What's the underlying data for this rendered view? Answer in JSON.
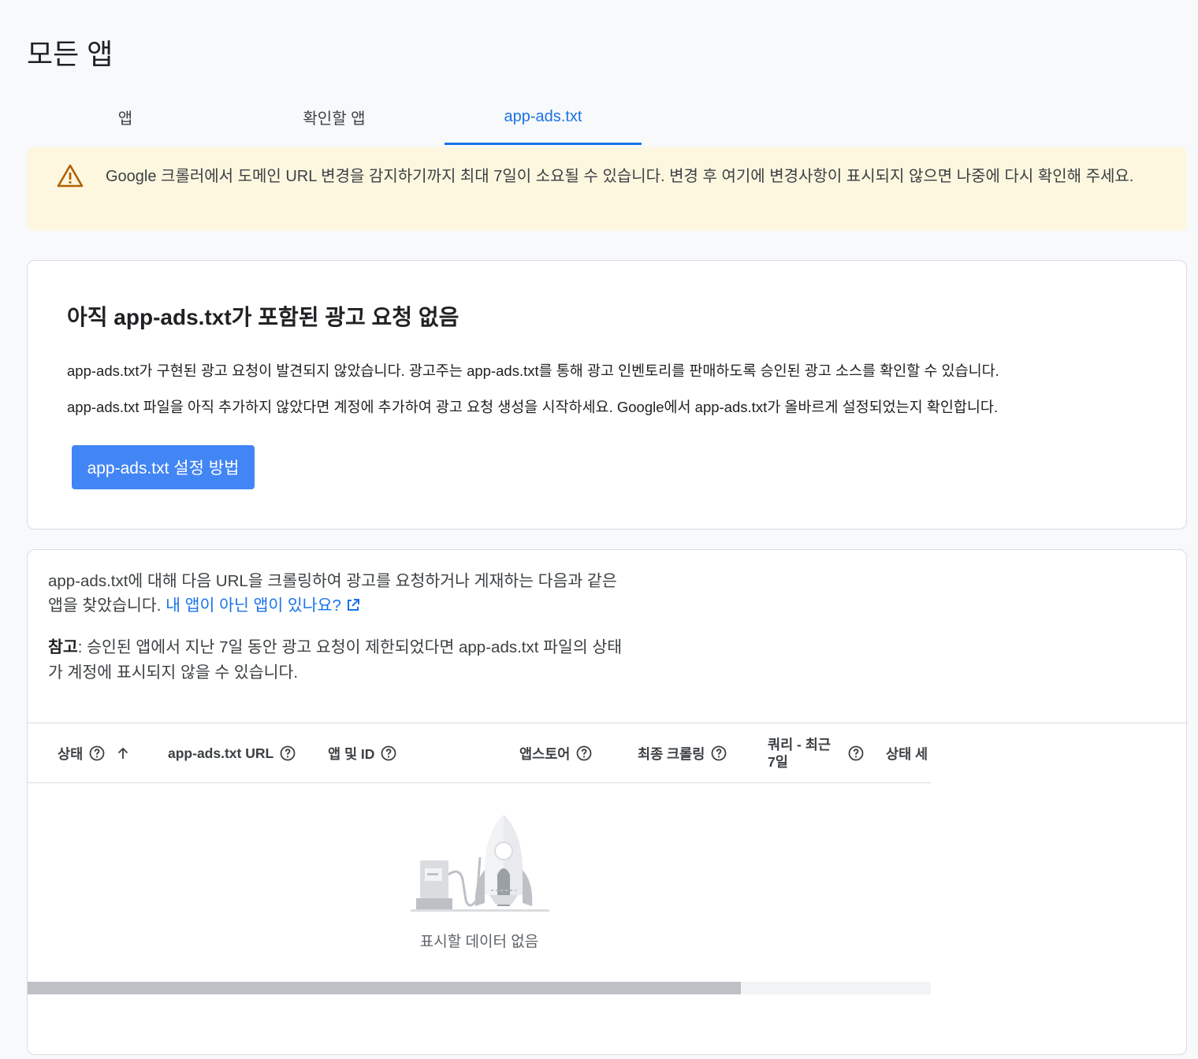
{
  "page": {
    "title": "모든 앱"
  },
  "tabs": [
    {
      "label": "앱",
      "active": false
    },
    {
      "label": "확인할 앱",
      "active": false
    },
    {
      "label": "app-ads.txt",
      "active": true
    }
  ],
  "warning": {
    "icon": "warning-triangle-icon",
    "text": "Google 크롤러에서 도메인 URL 변경을 감지하기까지 최대 7일이 소요될 수 있습니다. 변경 후 여기에 변경사항이 표시되지 않으면 나중에 다시 확인해 주세요."
  },
  "no_requests_card": {
    "title": "아직 app-ads.txt가 포함된 광고 요청 없음",
    "paragraph1": "app-ads.txt가 구현된 광고 요청이 발견되지 않았습니다. 광고주는 app-ads.txt를 통해 광고 인벤토리를 판매하도록 승인된 광고 소스를 확인할 수 있습니다.",
    "paragraph2": "app-ads.txt 파일을 아직 추가하지 않았다면 계정에 추가하여 광고 요청 생성을 시작하세요. Google에서 app-ads.txt가 올바르게 설정되었는지 확인합니다.",
    "button_label": "app-ads.txt 설정 방법"
  },
  "crawl_card": {
    "intro_text": "app-ads.txt에 대해 다음 URL을 크롤링하여 광고를 요청하거나 게재하는 다음과 같은 앱을 찾았습니다. ",
    "intro_link": "내 앱이 아닌 앱이 있나요?",
    "note_label": "참고",
    "note_text": ": 승인된 앱에서 지난 7일 동안 광고 요청이 제한되었다면 app-ads.txt 파일의 상태가 계정에 표시되지 않을 수 있습니다."
  },
  "table": {
    "columns": [
      {
        "label": "상태",
        "sorted": "ascending"
      },
      {
        "label": "app-ads.txt URL"
      },
      {
        "label": "앱 및 ID"
      },
      {
        "label": "앱스토어"
      },
      {
        "label": "최종 크롤링"
      },
      {
        "label": "쿼리 - 최근 7일"
      },
      {
        "label": "상태 세"
      }
    ],
    "empty_message": "표시할 데이터 없음",
    "horizontal_scroll_fraction": 0.79
  },
  "colors": {
    "accent": "#1a73e8",
    "button": "#4285f4",
    "warning_bg": "#fef7e0",
    "warning_icon": "#b06000"
  }
}
